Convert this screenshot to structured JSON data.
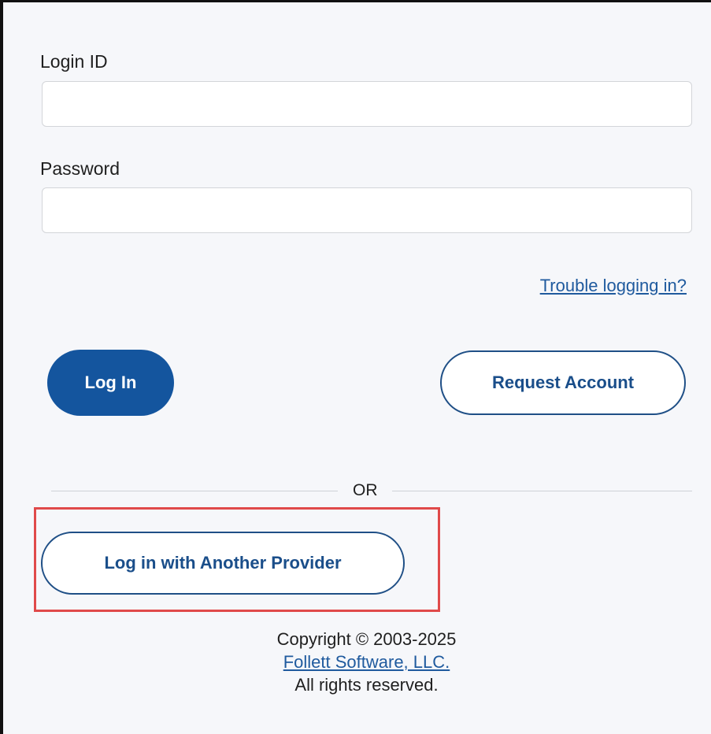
{
  "form": {
    "login_id_label": "Login ID",
    "login_id_value": "",
    "password_label": "Password",
    "password_value": "",
    "trouble_link": "Trouble logging in?"
  },
  "actions": {
    "login_label": "Log In",
    "request_account_label": "Request Account"
  },
  "divider": {
    "text": "OR"
  },
  "alt_login": {
    "provider_label": "Log in with Another Provider"
  },
  "footer": {
    "copyright": "Copyright © 2003-2025",
    "company_link": "Follett Software, LLC.",
    "rights": "All rights reserved."
  },
  "colors": {
    "primary": "#14559e",
    "link": "#1f5a9e",
    "highlight": "#e04a4a",
    "background": "#f6f7fa"
  }
}
